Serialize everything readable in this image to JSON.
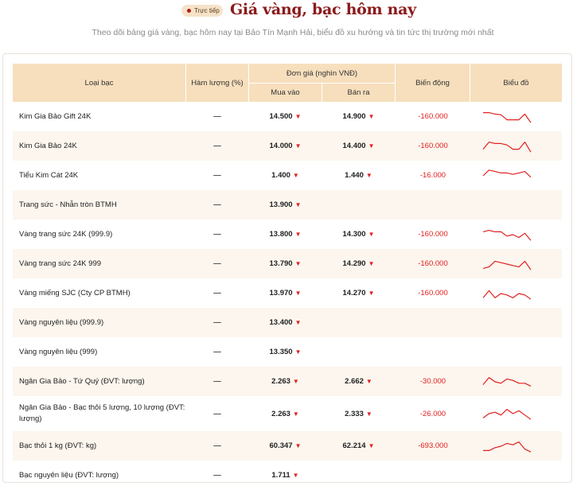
{
  "header": {
    "live_label": "Trực tiếp",
    "title": "Giá vàng, bạc hôm nay",
    "subtitle": "Theo dõi bảng giá vàng, bạc hôm nay tại Bảo Tín Mạnh Hải, biểu đồ xu hướng và tin tức thị trường mới nhất"
  },
  "colors": {
    "accent": "#8b1a1a",
    "down": "#e02020",
    "header_bg": "#f7dfbd"
  },
  "table": {
    "headers": {
      "type": "Loại bạc",
      "purity": "Hàm lượng (%)",
      "unit_price": "Đơn giá (nghìn VNĐ)",
      "buy": "Mua vào",
      "sell": "Bán ra",
      "change": "Biến động",
      "chart": "Biểu đồ"
    },
    "rows": [
      {
        "name": "Kim Gia Bảo Gift 24K",
        "purity": "—",
        "buy": "14.500",
        "sell": "14.900",
        "change": "-160.000",
        "spark": [
          0.2,
          0.2,
          0.3,
          0.35,
          0.7,
          0.7,
          0.7,
          0.3,
          0.9
        ]
      },
      {
        "name": "Kim Gia Bảo 24K",
        "purity": "—",
        "buy": "14.000",
        "sell": "14.400",
        "change": "-160.000",
        "spark": [
          0.7,
          0.2,
          0.3,
          0.3,
          0.4,
          0.7,
          0.7,
          0.2,
          0.9
        ]
      },
      {
        "name": "Tiểu Kim Cát 24K",
        "purity": "—",
        "buy": "1.400",
        "sell": "1.440",
        "change": "-16.000",
        "spark": [
          0.5,
          0.1,
          0.2,
          0.3,
          0.3,
          0.4,
          0.3,
          0.2,
          0.6
        ]
      },
      {
        "name": "Trang sức - Nhẫn tròn BTMH",
        "purity": "—",
        "buy": "13.900",
        "sell": "",
        "change": "",
        "spark": null
      },
      {
        "name": "Vàng trang sức 24K (999.9)",
        "purity": "—",
        "buy": "13.800",
        "sell": "14.300",
        "change": "-160.000",
        "spark": [
          0.3,
          0.2,
          0.3,
          0.3,
          0.6,
          0.5,
          0.7,
          0.4,
          0.9
        ]
      },
      {
        "name": "Vàng trang sức 24K 999",
        "purity": "—",
        "buy": "13.790",
        "sell": "14.290",
        "change": "-160.000",
        "spark": [
          0.8,
          0.7,
          0.3,
          0.4,
          0.5,
          0.6,
          0.7,
          0.3,
          0.9
        ]
      },
      {
        "name": "Vàng miếng SJC (Cty CP BTMH)",
        "purity": "—",
        "buy": "13.970",
        "sell": "14.270",
        "change": "-160.000",
        "spark": [
          0.8,
          0.3,
          0.8,
          0.5,
          0.6,
          0.8,
          0.5,
          0.6,
          0.9
        ]
      },
      {
        "name": "Vàng nguyên liệu (999.9)",
        "purity": "—",
        "buy": "13.400",
        "sell": "",
        "change": "",
        "spark": null
      },
      {
        "name": "Vàng nguyên liệu (999)",
        "purity": "—",
        "buy": "13.350",
        "sell": "",
        "change": "",
        "spark": null
      },
      {
        "name": "Ngân Gia Bảo - Tứ Quý (ĐVT: lượng)",
        "purity": "—",
        "buy": "2.263",
        "sell": "2.662",
        "change": "-30.000",
        "spark": [
          0.7,
          0.2,
          0.5,
          0.6,
          0.3,
          0.4,
          0.6,
          0.6,
          0.8
        ]
      },
      {
        "name": "Ngân Gia Bảo - Bạc thỏi 5 lượng, 10 lượng (ĐVT: lượng)",
        "purity": "—",
        "buy": "2.263",
        "sell": "2.333",
        "change": "-26.000",
        "spark": [
          0.8,
          0.5,
          0.4,
          0.6,
          0.2,
          0.5,
          0.3,
          0.6,
          0.9
        ]
      },
      {
        "name": "Bạc thỏi 1 kg (ĐVT: kg)",
        "purity": "—",
        "buy": "60.347",
        "sell": "62.214",
        "change": "-693.000",
        "spark": [
          0.8,
          0.8,
          0.6,
          0.5,
          0.3,
          0.4,
          0.2,
          0.7,
          0.9
        ]
      },
      {
        "name": "Bạc nguyên liệu (ĐVT: lượng)",
        "purity": "—",
        "buy": "1.711",
        "sell": "",
        "change": "",
        "spark": null
      }
    ]
  }
}
